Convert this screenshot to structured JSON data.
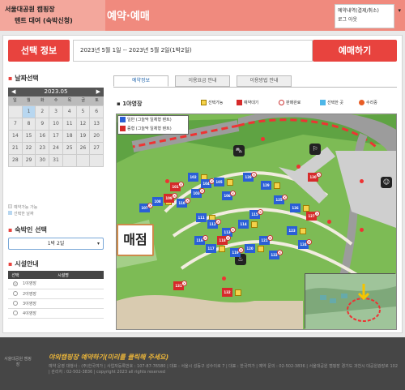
{
  "header": {
    "logo_line1": "서울대공원 캠핑장",
    "logo_line2": "텐트 대여 (숙박신청)",
    "title": "예약·예매",
    "user_menu": [
      "예약내역(결제/취소)",
      "로그 아웃"
    ]
  },
  "selection": {
    "label": "선택 정보",
    "value": "2023년 5월 1일 -- 2023년 5월 2일(1박2일)",
    "reserve_button": "예매하기"
  },
  "date_section": {
    "title": "날짜선택",
    "calendar": {
      "month": "2023.05",
      "weekdays": [
        "일",
        "월",
        "화",
        "수",
        "목",
        "금",
        "토"
      ],
      "cells": [
        "",
        "1",
        "2",
        "3",
        "4",
        "5",
        "6",
        "7",
        "8",
        "9",
        "10",
        "11",
        "12",
        "13",
        "14",
        "15",
        "16",
        "17",
        "18",
        "19",
        "20",
        "21",
        "22",
        "23",
        "24",
        "25",
        "26",
        "27",
        "28",
        "29",
        "30",
        "31",
        "",
        "",
        ""
      ],
      "selected": [
        "1"
      ]
    },
    "legend": [
      "예약가능 가능",
      "선택한 날짜"
    ]
  },
  "people_section": {
    "title": "숙박인 선택",
    "selected": "1박 2일"
  },
  "facility_section": {
    "title": "시설안내",
    "columns": [
      "선택",
      "시설명"
    ],
    "rows": [
      "1야영장",
      "2야영장",
      "3야영장",
      "4야영장"
    ],
    "selected_index": 0
  },
  "tabs": [
    "예약정보",
    "이용요금 안내",
    "이용방법 안내"
  ],
  "map": {
    "area_title": "1야영장",
    "legend": [
      "선택가능",
      "예약대기",
      "판매완료",
      "선택한 곳",
      "수리중"
    ],
    "map_legend": [
      "일반 (그늘막 일체형 텐트)",
      "증형 (그늘막 일체형 텐트)"
    ],
    "sign_text": "매점",
    "sites": [
      "101",
      "102",
      "103",
      "104",
      "105",
      "106",
      "107",
      "108",
      "109",
      "110",
      "111",
      "112",
      "113",
      "114",
      "115",
      "116",
      "117",
      "118",
      "119",
      "120",
      "121",
      "122",
      "123",
      "124",
      "125",
      "126",
      "127",
      "128",
      "129",
      "130",
      "131",
      "132"
    ]
  },
  "colors": {
    "accent": "#e8433e",
    "topbar": "#f08a7e",
    "site_normal": "#2a5fd6",
    "site_large": "#d62a2a",
    "map_green": "#7dbb55",
    "footer": "#464646",
    "promo": "#e9b43a"
  },
  "footer": {
    "logo": "서울대공원 캠핑장",
    "promo": "야외캠핑장 예약하기(미리를 클릭해 주세요)",
    "info": "예약 운영 대행사 : (주)한국여가 | 사업자등록번호 : 107-87-76580 | 대표 : 서울시 성동구 성수이로 7 | 대표 : 한국여가 | 예약 문의 : 02-502-3836 | 서울대공원 캠핑장 경기도 과천시 대공원광장로 102 | 관리처 : 02-502-3836 | copyright 2023 all rights reserved"
  }
}
